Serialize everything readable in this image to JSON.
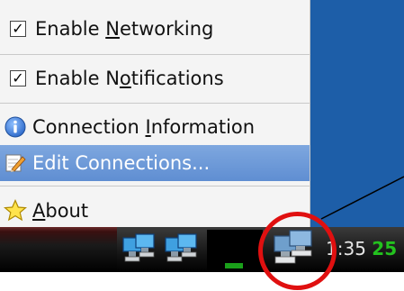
{
  "menu": {
    "items": [
      {
        "key": "networking",
        "pre": "Enable ",
        "ul": "N",
        "post": "etworking",
        "checked": true
      },
      {
        "key": "notifications",
        "pre": "Enable N",
        "ul": "o",
        "post": "tifications",
        "checked": true
      },
      {
        "key": "info",
        "pre": "Connection ",
        "ul": "I",
        "post": "nformation",
        "icon": "info-icon"
      },
      {
        "key": "edit",
        "pre": "Edit Connections...",
        "ul": "",
        "post": "",
        "icon": "edit-pencil-icon",
        "selected": true
      },
      {
        "key": "about",
        "pre": "",
        "ul": "A",
        "post": "bout",
        "icon": "star-icon"
      }
    ],
    "check_glyph": "✓"
  },
  "taskbar": {
    "clock_prefix": "1",
    "clock_main": ":35",
    "clock_suffix": "25"
  },
  "colors": {
    "selection": "#6a97d8",
    "highlight_circle": "#e01010",
    "desktop": "#1d5ea8",
    "clock_green": "#23c21e"
  }
}
